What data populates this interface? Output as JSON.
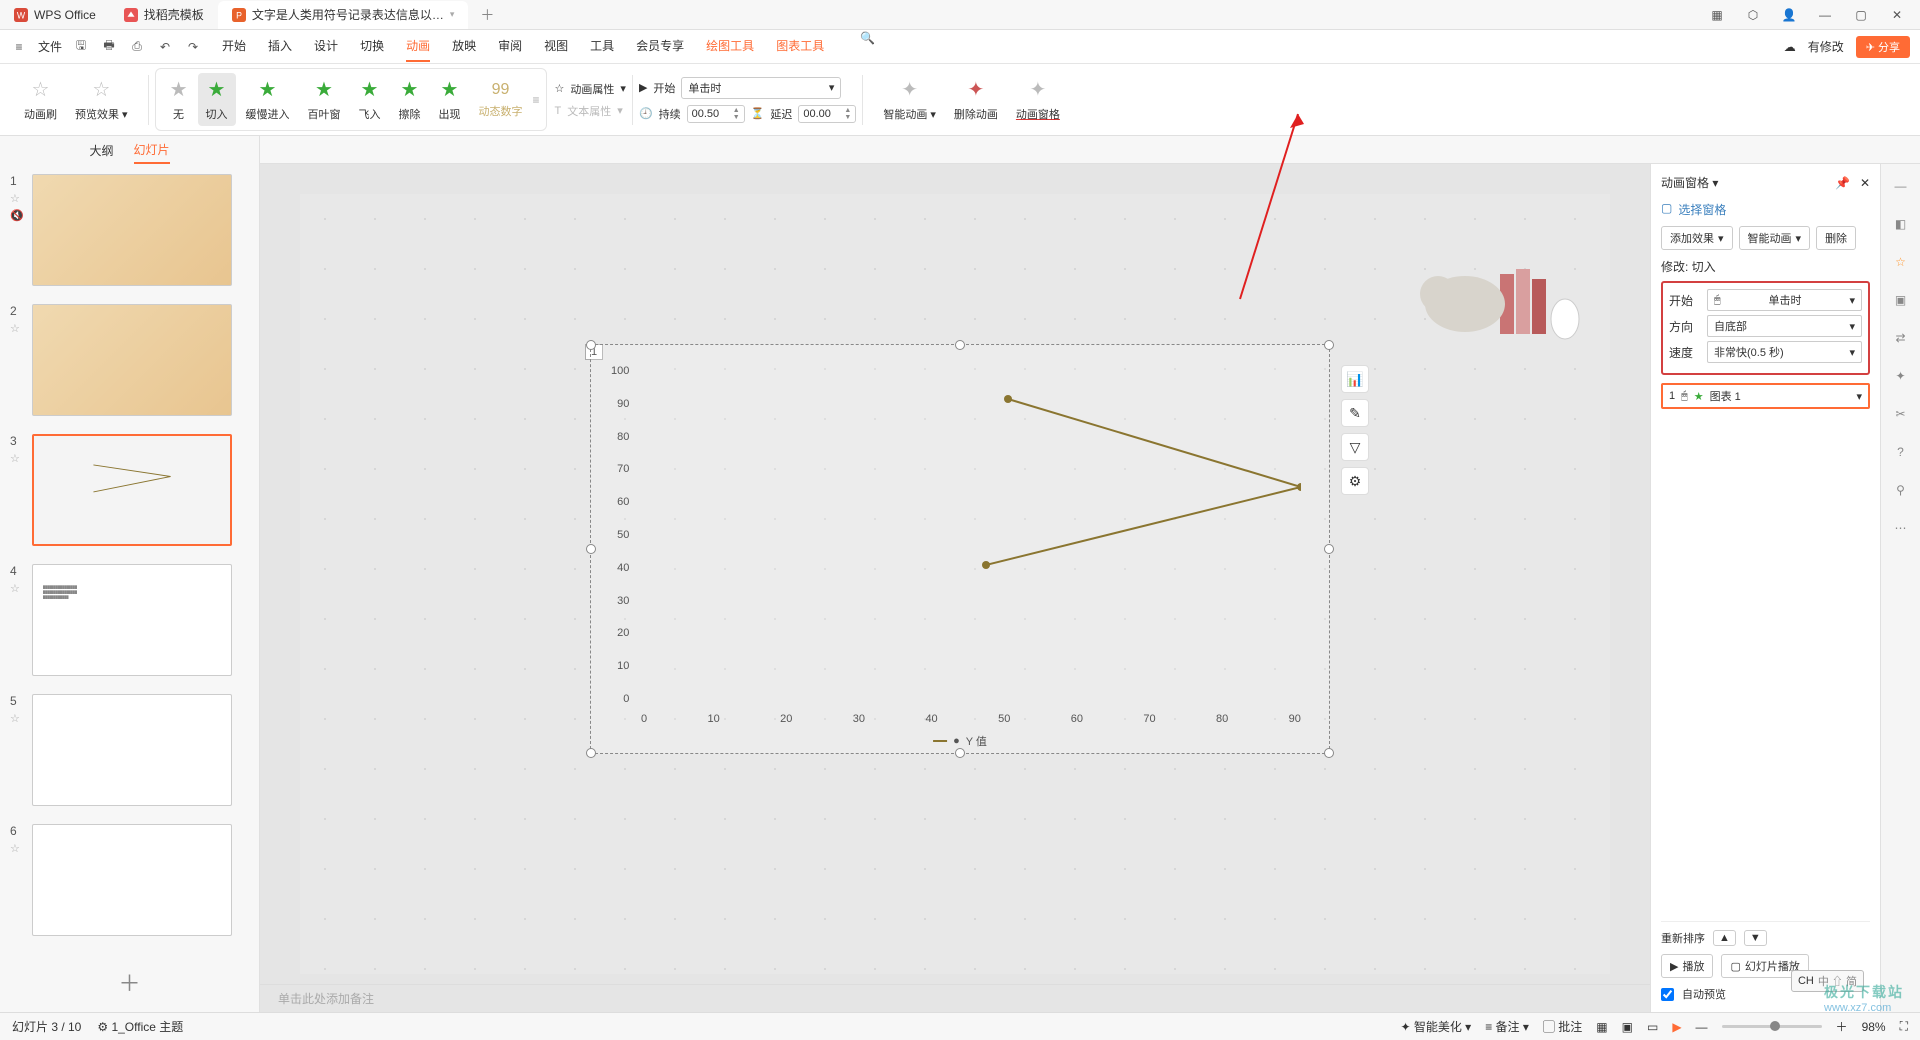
{
  "titlebar": {
    "tabs": [
      {
        "label": "WPS Office",
        "icon": "wps"
      },
      {
        "label": "找稻壳模板",
        "icon": "daoke"
      },
      {
        "label": "文字是人类用符号记录表达信息以…",
        "icon": "ppt",
        "active": true
      }
    ],
    "add": "＋"
  },
  "menubar": {
    "file": "文件",
    "items": [
      "开始",
      "插入",
      "设计",
      "切换",
      "动画",
      "放映",
      "审阅",
      "视图",
      "工具",
      "会员专享",
      "绘图工具",
      "图表工具"
    ],
    "active": "动画",
    "orange": [
      "绘图工具",
      "图表工具"
    ],
    "right": {
      "edit": "有修改",
      "share": "分享"
    }
  },
  "ribbon": {
    "brush": "动画刷",
    "preview": "预览效果",
    "anims": [
      {
        "label": "无",
        "color": "gray"
      },
      {
        "label": "切入",
        "color": "green",
        "selected": true
      },
      {
        "label": "缓慢进入",
        "color": "green"
      },
      {
        "label": "百叶窗",
        "color": "green"
      },
      {
        "label": "飞入",
        "color": "green"
      },
      {
        "label": "擦除",
        "color": "green"
      },
      {
        "label": "出现",
        "color": "green"
      },
      {
        "label": "动态数字",
        "color": "orange"
      }
    ],
    "anim_prop": "动画属性",
    "text_prop": "文本属性",
    "start_label": "开始",
    "start_value": "单击时",
    "duration_label": "持续",
    "duration_value": "00.50",
    "delay_label": "延迟",
    "delay_value": "00.00",
    "smart_anim": "智能动画",
    "del_anim": "删除动画",
    "anim_pane": "动画窗格"
  },
  "thumb_tabs": {
    "outline": "大纲",
    "slides": "幻灯片"
  },
  "chart_data": {
    "type": "line",
    "x_ticks": [
      0,
      10,
      20,
      30,
      40,
      50,
      60,
      70,
      80,
      90
    ],
    "y_ticks": [
      0,
      10,
      20,
      30,
      40,
      50,
      60,
      70,
      80,
      90,
      100
    ],
    "series": [
      {
        "name": "Y 值",
        "points": [
          [
            50,
            90
          ],
          [
            90,
            64
          ],
          [
            47,
            41
          ]
        ]
      }
    ],
    "legend": "Y 值"
  },
  "canvas": {
    "slide_num": "1",
    "notes_placeholder": "单击此处添加备注"
  },
  "panel": {
    "title": "动画窗格",
    "select_pane": "选择窗格",
    "add_effect": "添加效果",
    "smart_anim": "智能动画",
    "delete": "删除",
    "modify_label": "修改: 切入",
    "fields": {
      "start": {
        "label": "开始",
        "value": "单击时"
      },
      "direction": {
        "label": "方向",
        "value": "自底部"
      },
      "speed": {
        "label": "速度",
        "value": "非常快(0.5 秒)"
      }
    },
    "list_item": {
      "index": "1",
      "name": "图表 1"
    },
    "reorder": "重新排序",
    "play": "播放",
    "slideshow": "幻灯片播放",
    "auto_preview": "自动预览"
  },
  "status": {
    "slide": "幻灯片 3 / 10",
    "theme": "1_Office 主题",
    "beautify": "智能美化",
    "notes": "备注",
    "comments": "批注",
    "zoom": "98%"
  },
  "ime": {
    "lang": "CH",
    "sub": "中 ⇧ 简"
  },
  "watermark": {
    "cn": "极光下载站",
    "url": "www.xz7.com"
  }
}
